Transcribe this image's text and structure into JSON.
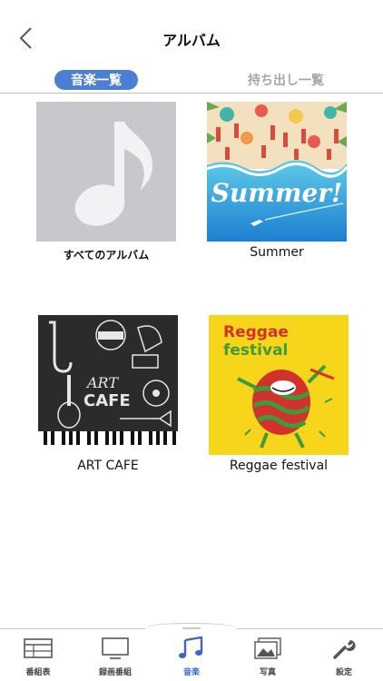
{
  "header": {
    "title": "アルバム",
    "back_icon": "chevron-left-icon"
  },
  "tabs": [
    {
      "label": "音楽一覧",
      "active": true
    },
    {
      "label": "持ち出し一覧",
      "active": false
    }
  ],
  "albums": [
    {
      "label": "すべてのアルバム",
      "cover": "music-note-placeholder"
    },
    {
      "label": "Summer",
      "cover": "summer-beach-art",
      "cover_text": "Summer!"
    },
    {
      "label": "ART CAFE",
      "cover": "art-cafe-art",
      "cover_text": "ART CAFE"
    },
    {
      "label": "Reggae festival",
      "cover": "reggae-festival-art",
      "cover_text_1": "Reggae",
      "cover_text_2": "festival"
    }
  ],
  "tabbar": {
    "items": [
      {
        "label": "番組表",
        "icon": "program-guide-icon",
        "active": false
      },
      {
        "label": "録画番組",
        "icon": "tv-icon",
        "active": false
      },
      {
        "label": "音楽",
        "icon": "music-icon",
        "active": true
      },
      {
        "label": "写真",
        "icon": "photo-icon",
        "active": false
      },
      {
        "label": "設定",
        "icon": "wrench-icon",
        "active": false
      }
    ]
  },
  "colors": {
    "accent": "#4a7fd3",
    "tab_inactive": "#a7a7a7",
    "reggae_bg": "#f7d51b",
    "art_bg": "#2b2b2b"
  }
}
